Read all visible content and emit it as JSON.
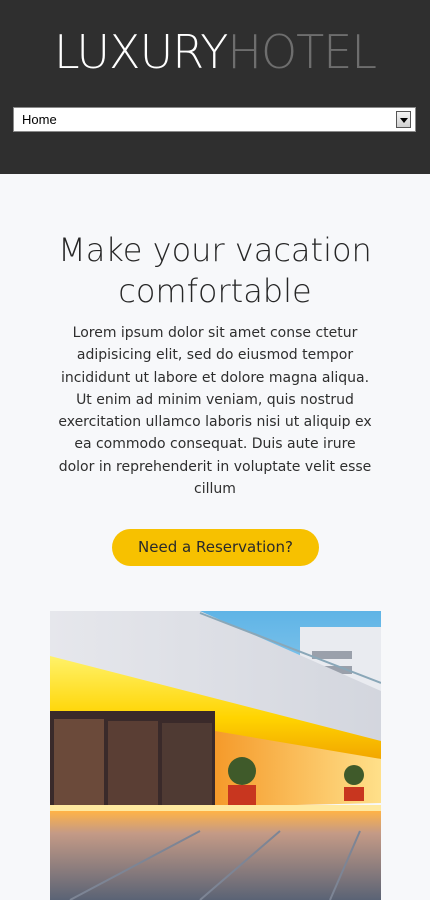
{
  "header": {
    "logo_word1": "LUXURY",
    "logo_word2": "HOTEL",
    "nav_selected": "Home"
  },
  "hero": {
    "title": "Make your vacation comfortable",
    "text": "Lorem ipsum dolor sit amet conse ctetur adipisicing elit, sed do eiusmod tempor incididunt ut labore et dolore magna aliqua. Ut enim ad minim veniam, quis nostrud exercitation ullamco laboris nisi ut aliquip ex ea commodo consequat. Duis aute irure dolor in reprehenderit in voluptate velit esse cillum",
    "cta_label": "Need a Reservation?"
  },
  "colors": {
    "header_bg": "#2f2f2f",
    "accent": "#f7c100",
    "page_bg": "#f7f8fa"
  },
  "icons": {
    "dropdown": "chevron-down-icon"
  }
}
